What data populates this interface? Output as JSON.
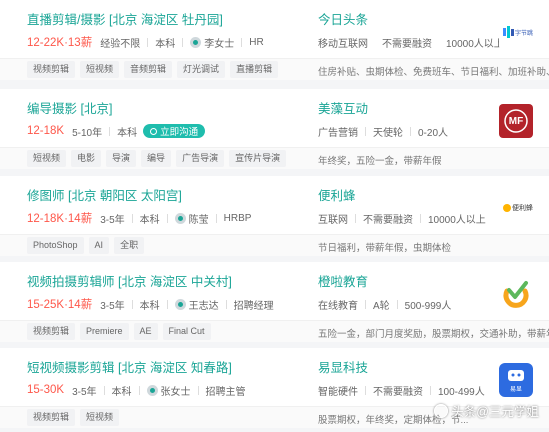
{
  "jobs": [
    {
      "title": "直播剪辑/摄影 [北京 海淀区 牡丹园]",
      "salary": "12-22K·13薪",
      "meta": [
        "经验不限",
        "本科"
      ],
      "recruiter": "李女士",
      "recruiter_role": "HR",
      "chat_label": "",
      "company": "今日头条",
      "company_meta": [
        "移动互联网",
        "不需要融资",
        "10000人以上"
      ],
      "tags": [
        "视频剪辑",
        "短视频",
        "音频剪辑",
        "灯光调试",
        "直播剪辑"
      ],
      "benefits": "住房补贴、虫期体检、免费班车、节日福利、加班补助、...",
      "logo": {
        "type": "toutiao",
        "bg": "#ffffff",
        "text": "字节跳动"
      }
    },
    {
      "title": "编导摄影 [北京]",
      "salary": "12-18K",
      "meta": [
        "5-10年",
        "本科"
      ],
      "recruiter": "",
      "recruiter_role": "",
      "chat_label": "立即沟通",
      "company": "美藻互动",
      "company_meta": [
        "广告营销",
        "天使轮",
        "0-20人"
      ],
      "tags": [
        "短视频",
        "电影",
        "导演",
        "编导",
        "广告导演",
        "宣传片导演"
      ],
      "benefits": "年终奖，五险一金，带薪年假",
      "logo": {
        "type": "mf",
        "bg": "#b3232a",
        "text": "MF"
      }
    },
    {
      "title": "修图师 [北京 朝阳区 太阳宫]",
      "salary": "12-18K·14薪",
      "meta": [
        "3-5年",
        "本科"
      ],
      "recruiter": "陈莹",
      "recruiter_role": "HRBP",
      "chat_label": "",
      "company": "便利蜂",
      "company_meta": [
        "互联网",
        "不需要融资",
        "10000人以上"
      ],
      "tags": [
        "PhotoShop",
        "AI",
        "全职"
      ],
      "benefits": "节日福利，带薪年假，虫期体检",
      "logo": {
        "type": "bianlifeng",
        "bg": "#ffffff",
        "text": "便利蜂"
      }
    },
    {
      "title": "视频拍摄剪辑师 [北京 海淀区 中关村]",
      "salary": "15-25K·14薪",
      "meta": [
        "3-5年",
        "本科"
      ],
      "recruiter": "王志达",
      "recruiter_role": "招聘经理",
      "chat_label": "",
      "company": "橙啦教育",
      "company_meta": [
        "在线教育",
        "A轮",
        "500-999人"
      ],
      "tags": [
        "视频剪辑",
        "Premiere",
        "AE",
        "Final Cut"
      ],
      "benefits": "五险一金，部门月度奖励，股票期权，交通补助，带薪年...",
      "logo": {
        "type": "chengla",
        "bg": "#ffffff",
        "text": ""
      }
    },
    {
      "title": "短视频摄影剪辑 [北京 海淀区 知春路]",
      "salary": "15-30K",
      "meta": [
        "3-5年",
        "本科"
      ],
      "recruiter": "张女士",
      "recruiter_role": "招聘主管",
      "chat_label": "",
      "company": "易显科技",
      "company_meta": [
        "智能硬件",
        "不需要融资",
        "100-499人"
      ],
      "tags": [
        "视频剪辑",
        "短视频"
      ],
      "benefits": "股票期权，年终奖，定期体检，节...",
      "logo": {
        "type": "yixian",
        "bg": "#2d6be0",
        "text": "易显"
      }
    }
  ],
  "watermark": "头条@三元学姐"
}
